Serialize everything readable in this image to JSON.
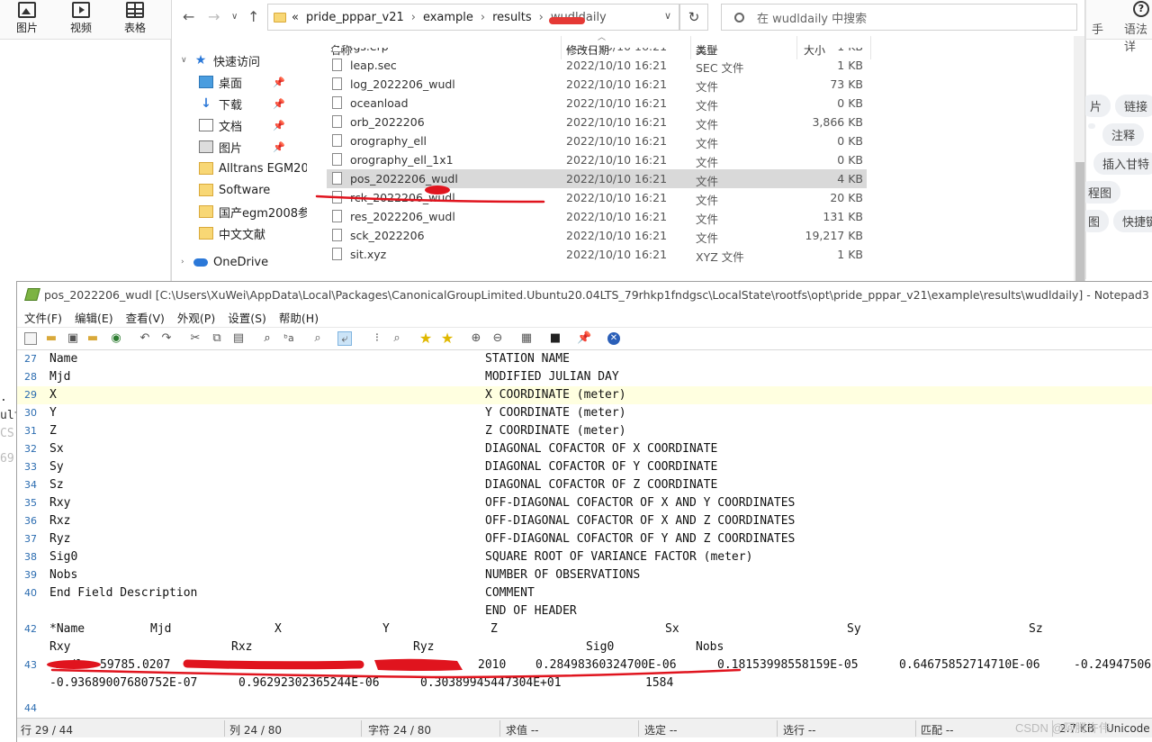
{
  "bg_doc": {
    "ribbon": [
      {
        "label": "图片",
        "icon": "picture-icon"
      },
      {
        "label": "视频",
        "icon": "video-icon"
      },
      {
        "label": "表格",
        "icon": "table-icon"
      }
    ],
    "fragments": [
      ".",
      "ult",
      "CS",
      "69"
    ]
  },
  "bg_right": {
    "top_labels": [
      "手",
      "语法详"
    ],
    "pills": [
      "片",
      "链接",
      "注释",
      "插入甘特",
      "程图",
      "图",
      "快捷键"
    ]
  },
  "explorer": {
    "address": {
      "overflow": "«",
      "crumbs": [
        "pride_pppar_v21",
        "example",
        "results",
        "wudldaily"
      ]
    },
    "search_placeholder": "在 wudldaily 中搜索",
    "nav": {
      "quick_access": "快速访问",
      "items": [
        "桌面",
        "下载",
        "文档",
        "图片",
        "Alltrans EGM2008",
        "Software",
        "国产egm2008参",
        "中文文献"
      ],
      "onedrive": "OneDrive"
    },
    "columns": {
      "name": "名称",
      "date": "修改日期",
      "type": "类型",
      "size": "大小"
    },
    "files": [
      {
        "name": "igs.erp",
        "date": "2022/10/10 16:21",
        "type": "文件",
        "size": "1 KB"
      },
      {
        "name": "leap.sec",
        "date": "2022/10/10 16:21",
        "type": "SEC 文件",
        "size": "1 KB"
      },
      {
        "name": "log_2022206_wudl",
        "date": "2022/10/10 16:21",
        "type": "文件",
        "size": "73 KB"
      },
      {
        "name": "oceanload",
        "date": "2022/10/10 16:21",
        "type": "文件",
        "size": "0 KB"
      },
      {
        "name": "orb_2022206",
        "date": "2022/10/10 16:21",
        "type": "文件",
        "size": "3,866 KB"
      },
      {
        "name": "orography_ell",
        "date": "2022/10/10 16:21",
        "type": "文件",
        "size": "0 KB"
      },
      {
        "name": "orography_ell_1x1",
        "date": "2022/10/10 16:21",
        "type": "文件",
        "size": "0 KB"
      },
      {
        "name": "pos_2022206_wudl",
        "date": "2022/10/10 16:21",
        "type": "文件",
        "size": "4 KB",
        "selected": true
      },
      {
        "name": "rck_2022206_wudl",
        "date": "2022/10/10 16:21",
        "type": "文件",
        "size": "20 KB"
      },
      {
        "name": "res_2022206_wudl",
        "date": "2022/10/10 16:21",
        "type": "文件",
        "size": "131 KB"
      },
      {
        "name": "sck_2022206",
        "date": "2022/10/10 16:21",
        "type": "文件",
        "size": "19,217 KB"
      },
      {
        "name": "sit.xyz",
        "date": "2022/10/10 16:21",
        "type": "XYZ 文件",
        "size": "1 KB"
      }
    ]
  },
  "notepad": {
    "title": "pos_2022206_wudl [C:\\Users\\XuWei\\AppData\\Local\\Packages\\CanonicalGroupLimited.Ubuntu20.04LTS_79rhkp1fndgsc\\LocalState\\rootfs\\opt\\pride_pppar_v21\\example\\results\\wudldaily] - Notepad3",
    "menu": [
      "文件(F)",
      "编辑(E)",
      "查看(V)",
      "外观(P)",
      "设置(S)",
      "帮助(H)"
    ],
    "lines": [
      {
        "n": "27",
        "a": "Name",
        "b": "STATION NAME"
      },
      {
        "n": "28",
        "a": "Mjd",
        "b": "MODIFIED JULIAN DAY"
      },
      {
        "n": "29",
        "a": "X",
        "b": "X COORDINATE (meter)"
      },
      {
        "n": "30",
        "a": "Y",
        "b": "Y COORDINATE (meter)"
      },
      {
        "n": "31",
        "a": "Z",
        "b": "Z COORDINATE (meter)"
      },
      {
        "n": "32",
        "a": "Sx",
        "b": "DIAGONAL COFACTOR OF X COORDINATE"
      },
      {
        "n": "33",
        "a": "Sy",
        "b": "DIAGONAL COFACTOR OF Y COORDINATE"
      },
      {
        "n": "34",
        "a": "Sz",
        "b": "DIAGONAL COFACTOR OF Z COORDINATE"
      },
      {
        "n": "35",
        "a": "Rxy",
        "b": "OFF-DIAGONAL COFACTOR OF X AND Y COORDINATES"
      },
      {
        "n": "36",
        "a": "Rxz",
        "b": "OFF-DIAGONAL COFACTOR OF X AND Z COORDINATES"
      },
      {
        "n": "37",
        "a": "Ryz",
        "b": "OFF-DIAGONAL COFACTOR OF Y AND Z COORDINATES"
      },
      {
        "n": "38",
        "a": "Sig0",
        "b": "SQUARE ROOT OF VARIANCE FACTOR (meter)"
      },
      {
        "n": "39",
        "a": "Nobs",
        "b": "NUMBER OF OBSERVATIONS"
      },
      {
        "n": "40",
        "a": "End Field Description",
        "b": "COMMENT"
      },
      {
        "n": "",
        "a": "",
        "b": "END OF HEADER"
      }
    ],
    "header_line": {
      "n": "42",
      "cols1": [
        "*Name",
        "Mjd",
        "X",
        "Y",
        "Z",
        "Sx",
        "Sy",
        "Sz"
      ],
      "cols2": [
        "Rxy",
        "Rxz",
        "Ryz",
        "Sig0",
        "Nobs"
      ]
    },
    "data_line": {
      "n": "43",
      "row1": [
        "wudl",
        "59785.0207",
        "",
        "",
        "2010",
        "0.28498360324700E-06",
        "0.18153998558159E-05",
        "0.64675852714710E-06",
        "-0.24947506"
      ],
      "row2": [
        "-0.93689007680752E-07",
        "0.96292302365244E-06",
        "0.30389945447304E+01",
        "1584"
      ]
    },
    "last_line": "44",
    "status": {
      "line": "行  29 / 44",
      "col": "列  24 / 80",
      "char": "字符  24 / 80",
      "eval": "求值  --",
      "sel": "选定  --",
      "sel_lines": "选行  --",
      "match": "匹配  --",
      "size": "2.7 KB",
      "enc": "Unicode"
    }
  },
  "watermark": "CSDN @阿腾许伟"
}
